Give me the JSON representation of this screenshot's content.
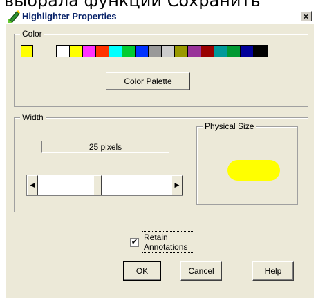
{
  "background_text": "выбрала функции Сохранить",
  "dialog": {
    "title": "Highlighter Properties",
    "close_symbol": "×"
  },
  "color_group": {
    "label": "Color",
    "selected_color": "#ffff00",
    "palette_colors": [
      "#ffffff",
      "#ffff00",
      "#ff33ff",
      "#ff3300",
      "#00ffff",
      "#00cc33",
      "#0033ff",
      "#999999",
      "#cccccc",
      "#999900",
      "#993399",
      "#990000",
      "#009999",
      "#009933",
      "#000099",
      "#000000"
    ],
    "palette_button_label": "Color Palette"
  },
  "width_group": {
    "label": "Width",
    "readout": "25 pixels",
    "slider_value_fraction": 0.44,
    "left_arrow": "◀",
    "right_arrow": "▶",
    "physical_size": {
      "label": "Physical Size",
      "preview_color": "#ffff00"
    }
  },
  "retain": {
    "checked": true,
    "check_mark": "✔",
    "label_line1": "Retain",
    "label_line2": "Annotations"
  },
  "buttons": {
    "ok": "OK",
    "cancel": "Cancel",
    "help": "Help"
  }
}
